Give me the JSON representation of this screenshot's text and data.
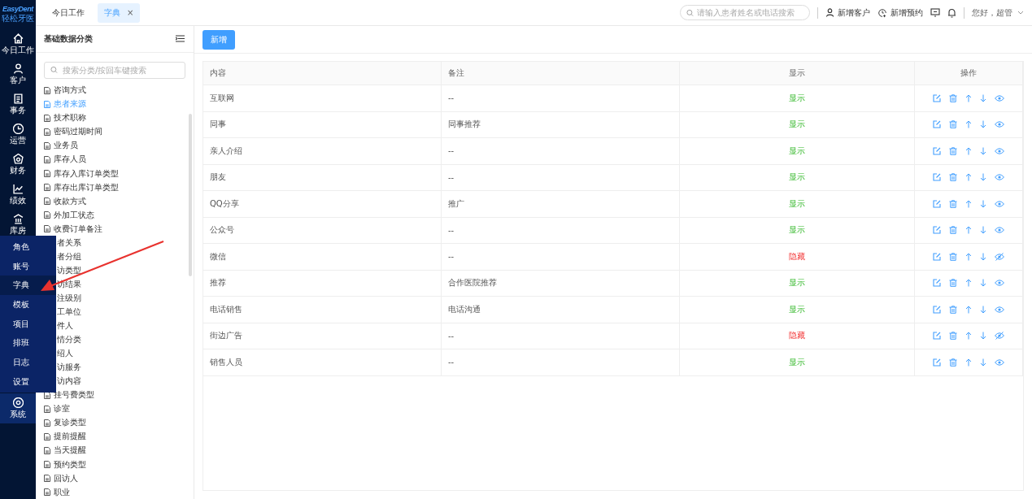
{
  "logo": {
    "name": "EasyDent",
    "subtitle": "轻松牙医"
  },
  "nav": [
    {
      "label": "今日工作",
      "selected": false
    },
    {
      "label": "客户",
      "selected": false
    },
    {
      "label": "事务",
      "selected": false
    },
    {
      "label": "运营",
      "selected": false
    },
    {
      "label": "财务",
      "selected": false
    },
    {
      "label": "绩效",
      "selected": false
    },
    {
      "label": "库房",
      "selected": false
    },
    {
      "label": "系统",
      "selected": true
    }
  ],
  "system_menu": [
    {
      "label": "角色",
      "selected": false
    },
    {
      "label": "账号",
      "selected": false
    },
    {
      "label": "字典",
      "selected": true
    },
    {
      "label": "模板",
      "selected": false
    },
    {
      "label": "项目",
      "selected": false
    },
    {
      "label": "排班",
      "selected": false
    },
    {
      "label": "日志",
      "selected": false
    },
    {
      "label": "设置",
      "selected": false
    }
  ],
  "tabs": [
    {
      "label": "今日工作",
      "selected": false
    },
    {
      "label": "字典",
      "selected": true,
      "close": "×"
    }
  ],
  "header": {
    "search": {
      "placeholder": "请输入患者姓名或电话搜索"
    },
    "new_customer": "新增客户",
    "new_appointment": "新增预约",
    "greeting": "您好，超管"
  },
  "category_panel": {
    "title": "基础数据分类",
    "search": {
      "placeholder": "搜索分类/按回车键搜索"
    },
    "items": [
      {
        "label": "咨询方式",
        "selected": false,
        "covered": false
      },
      {
        "label": "患者来源",
        "selected": true,
        "covered": false
      },
      {
        "label": "技术职称",
        "selected": false,
        "covered": false
      },
      {
        "label": "密码过期时间",
        "selected": false,
        "covered": false
      },
      {
        "label": "业务员",
        "selected": false,
        "covered": false
      },
      {
        "label": "库存人员",
        "selected": false,
        "covered": false
      },
      {
        "label": "库存入库订单类型",
        "selected": false,
        "covered": false
      },
      {
        "label": "库存出库订单类型",
        "selected": false,
        "covered": false
      },
      {
        "label": "收款方式",
        "selected": false,
        "covered": false
      },
      {
        "label": "外加工状态",
        "selected": false,
        "covered": false
      },
      {
        "label": "收费订单备注",
        "selected": false,
        "covered": false
      },
      {
        "label": "者关系",
        "selected": false,
        "covered": true
      },
      {
        "label": "者分组",
        "selected": false,
        "covered": true
      },
      {
        "label": "访类型",
        "selected": false,
        "covered": true
      },
      {
        "label": "访结果",
        "selected": false,
        "covered": true
      },
      {
        "label": "注级别",
        "selected": false,
        "covered": true
      },
      {
        "label": "工单位",
        "selected": false,
        "covered": true
      },
      {
        "label": "件人",
        "selected": false,
        "covered": true
      },
      {
        "label": "情分类",
        "selected": false,
        "covered": true
      },
      {
        "label": "绍人",
        "selected": false,
        "covered": true
      },
      {
        "label": "访服务",
        "selected": false,
        "covered": true
      },
      {
        "label": "访内容",
        "selected": false,
        "covered": true
      },
      {
        "label": "挂号费类型",
        "selected": false,
        "covered": false
      },
      {
        "label": "诊室",
        "selected": false,
        "covered": false
      },
      {
        "label": "复诊类型",
        "selected": false,
        "covered": false
      },
      {
        "label": "提前提醒",
        "selected": false,
        "covered": false
      },
      {
        "label": "当天提醒",
        "selected": false,
        "covered": false
      },
      {
        "label": "预约类型",
        "selected": false,
        "covered": false
      },
      {
        "label": "回访人",
        "selected": false,
        "covered": false
      },
      {
        "label": "职业",
        "selected": false,
        "covered": false
      }
    ]
  },
  "add_button": "新增",
  "table": {
    "columns": [
      "内容",
      "备注",
      "显示",
      "操作"
    ],
    "rows": [
      {
        "content": "互联网",
        "note": "--",
        "display": "显示",
        "shown": true
      },
      {
        "content": "同事",
        "note": "同事推荐",
        "display": "显示",
        "shown": true
      },
      {
        "content": "亲人介绍",
        "note": "--",
        "display": "显示",
        "shown": true
      },
      {
        "content": "朋友",
        "note": "--",
        "display": "显示",
        "shown": true
      },
      {
        "content": "QQ分享",
        "note": "推广",
        "display": "显示",
        "shown": true
      },
      {
        "content": "公众号",
        "note": "--",
        "display": "显示",
        "shown": true
      },
      {
        "content": "微信",
        "note": "--",
        "display": "隐藏",
        "shown": false
      },
      {
        "content": "推荐",
        "note": "合作医院推荐",
        "display": "显示",
        "shown": true
      },
      {
        "content": "电话销售",
        "note": "电话沟通",
        "display": "显示",
        "shown": true
      },
      {
        "content": "街边广告",
        "note": "--",
        "display": "隐藏",
        "shown": false
      },
      {
        "content": "销售人员",
        "note": "--",
        "display": "显示",
        "shown": true
      }
    ]
  }
}
